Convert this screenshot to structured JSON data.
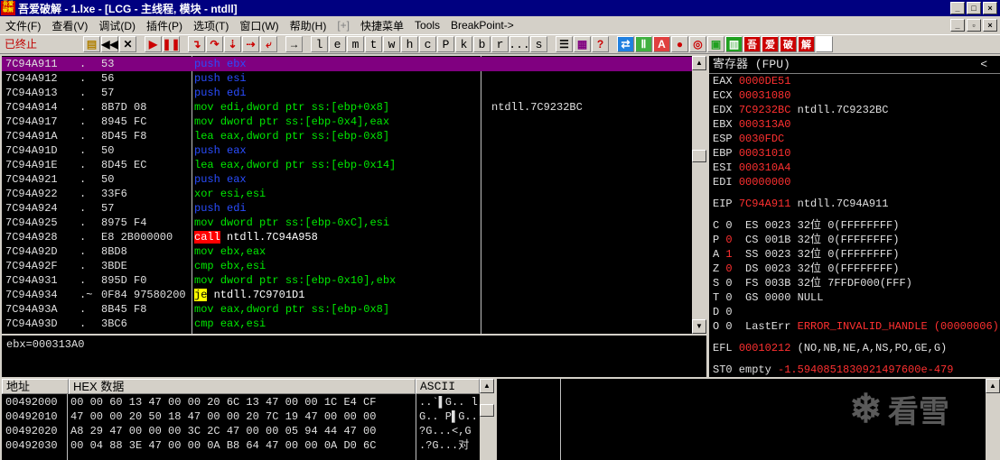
{
  "titlebar": {
    "icon_text": "吾爱破解",
    "title": "吾爱破解 - 1.lxe - [LCG - 主线程, 模块 - ntdll]"
  },
  "menu": [
    "文件(F)",
    "查看(V)",
    "调试(D)",
    "插件(P)",
    "选项(T)",
    "窗口(W)",
    "帮助(H)",
    "[+]",
    "快捷菜单",
    "Tools",
    "BreakPoint->"
  ],
  "toolbar": {
    "status": "已终止",
    "letters": [
      "l",
      "e",
      "m",
      "t",
      "w",
      "h",
      "c",
      "P",
      "k",
      "b",
      "r",
      "...",
      "s"
    ]
  },
  "disasm": {
    "rows": [
      {
        "addr": "7C94A911",
        "mark": ".",
        "hex": "53",
        "op": "push",
        "args": "ebx",
        "opclass": "push",
        "comment": "",
        "sel": true
      },
      {
        "addr": "7C94A912",
        "mark": ".",
        "hex": "56",
        "op": "push",
        "args": "esi",
        "opclass": "push",
        "comment": ""
      },
      {
        "addr": "7C94A913",
        "mark": ".",
        "hex": "57",
        "op": "push",
        "args": "edi",
        "opclass": "push",
        "comment": ""
      },
      {
        "addr": "7C94A914",
        "mark": ".",
        "hex": "8B7D 08",
        "op": "mov",
        "args": "edi,dword ptr ss:[ebp+0x8]",
        "opclass": "mov",
        "comment": "ntdll.7C9232BC"
      },
      {
        "addr": "7C94A917",
        "mark": ".",
        "hex": "8945 FC",
        "op": "mov",
        "args": "dword ptr ss:[ebp-0x4],eax",
        "opclass": "mov",
        "comment": ""
      },
      {
        "addr": "7C94A91A",
        "mark": ".",
        "hex": "8D45 F8",
        "op": "lea",
        "args": "eax,dword ptr ss:[ebp-0x8]",
        "opclass": "mov",
        "comment": ""
      },
      {
        "addr": "7C94A91D",
        "mark": ".",
        "hex": "50",
        "op": "push",
        "args": "eax",
        "opclass": "push",
        "comment": ""
      },
      {
        "addr": "7C94A91E",
        "mark": ".",
        "hex": "8D45 EC",
        "op": "lea",
        "args": "eax,dword ptr ss:[ebp-0x14]",
        "opclass": "mov",
        "comment": ""
      },
      {
        "addr": "7C94A921",
        "mark": ".",
        "hex": "50",
        "op": "push",
        "args": "eax",
        "opclass": "push",
        "comment": ""
      },
      {
        "addr": "7C94A922",
        "mark": ".",
        "hex": "33F6",
        "op": "xor",
        "args": "esi,esi",
        "opclass": "mov",
        "comment": ""
      },
      {
        "addr": "7C94A924",
        "mark": ".",
        "hex": "57",
        "op": "push",
        "args": "edi",
        "opclass": "push",
        "comment": ""
      },
      {
        "addr": "7C94A925",
        "mark": ".",
        "hex": "8975 F4",
        "op": "mov",
        "args": "dword ptr ss:[ebp-0xC],esi",
        "opclass": "mov",
        "comment": ""
      },
      {
        "addr": "7C94A928",
        "mark": ".",
        "hex": "E8 2B000000",
        "op": "call",
        "args": "ntdll.7C94A958",
        "opclass": "call",
        "comment": ""
      },
      {
        "addr": "7C94A92D",
        "mark": ".",
        "hex": "8BD8",
        "op": "mov",
        "args": "ebx,eax",
        "opclass": "mov",
        "comment": ""
      },
      {
        "addr": "7C94A92F",
        "mark": ".",
        "hex": "3BDE",
        "op": "cmp",
        "args": "ebx,esi",
        "opclass": "mov",
        "comment": ""
      },
      {
        "addr": "7C94A931",
        "mark": ".",
        "hex": "895D F0",
        "op": "mov",
        "args": "dword ptr ss:[ebp-0x10],ebx",
        "opclass": "mov",
        "comment": ""
      },
      {
        "addr": "7C94A934",
        "mark": ".~",
        "hex": "0F84 97580200",
        "op": "je",
        "args": "ntdll.7C9701D1",
        "opclass": "je",
        "comment": ""
      },
      {
        "addr": "7C94A93A",
        "mark": ".",
        "hex": "8B45 F8",
        "op": "mov",
        "args": "eax,dword ptr ss:[ebp-0x8]",
        "opclass": "mov",
        "comment": ""
      },
      {
        "addr": "7C94A93D",
        "mark": ".",
        "hex": "3BC6",
        "op": "cmp",
        "args": "eax,esi",
        "opclass": "mov",
        "comment": ""
      }
    ]
  },
  "info": {
    "text": "ebx=000313A0"
  },
  "registers": {
    "title": "寄存器 (FPU)",
    "collapse": "<",
    "gp": [
      {
        "name": "EAX",
        "value": "0000DE51",
        "extra": ""
      },
      {
        "name": "ECX",
        "value": "00031080",
        "extra": ""
      },
      {
        "name": "EDX",
        "value": "7C9232BC",
        "extra": "ntdll.7C9232BC"
      },
      {
        "name": "EBX",
        "value": "000313A0",
        "extra": ""
      },
      {
        "name": "ESP",
        "value": "0030FDC",
        "extra": ""
      },
      {
        "name": "EBP",
        "value": "00031010",
        "extra": ""
      },
      {
        "name": "ESI",
        "value": "000310A4",
        "extra": ""
      },
      {
        "name": "EDI",
        "value": "00000000",
        "extra": ""
      }
    ],
    "eip": {
      "name": "EIP",
      "value": "7C94A911",
      "extra": "ntdll.7C94A911"
    },
    "flags": [
      {
        "f": "C",
        "v": "0",
        "red": false,
        "seg": "ES 0023 32位 0(FFFFFFFF)"
      },
      {
        "f": "P",
        "v": "0",
        "red": true,
        "seg": "CS 001B 32位 0(FFFFFFFF)"
      },
      {
        "f": "A",
        "v": "1",
        "red": true,
        "seg": "SS 0023 32位 0(FFFFFFFF)"
      },
      {
        "f": "Z",
        "v": "0",
        "red": true,
        "seg": "DS 0023 32位 0(FFFFFFFF)"
      },
      {
        "f": "S",
        "v": "0",
        "red": false,
        "seg": "FS 003B 32位 7FFDF000(FFF)"
      },
      {
        "f": "T",
        "v": "0",
        "red": false,
        "seg": "GS 0000 NULL"
      },
      {
        "f": "D",
        "v": "0",
        "red": false,
        "seg": ""
      }
    ],
    "lasterr": {
      "label": "O 0  LastErr",
      "value": "ERROR_INVALID_HANDLE (00000006)"
    },
    "efl": {
      "label": "EFL",
      "value": "00010212",
      "extra": "(NO,NB,NE,A,NS,PO,GE,G)"
    },
    "st0": {
      "label": "ST0 empty",
      "value": "-1.5940851830921497600e-479"
    }
  },
  "dump": {
    "headers": {
      "addr": "地址",
      "hex": "HEX 数据",
      "ascii": "ASCII"
    },
    "rows": [
      {
        "addr": "00492000",
        "hex": "00 00 60 13 47 00 00 20 6C 13 47 00 00 1C E4 CF",
        "ascii": "..`▌G.. l"
      },
      {
        "addr": "00492010",
        "hex": "47 00 00 20 50 18 47 00 00 20 7C 19 47 00 00 00",
        "ascii": "G.. P▌G.."
      },
      {
        "addr": "00492020",
        "hex": "A8 29 47 00 00 00 3C 2C 47 00 00 05 94 44 47 00",
        "ascii": "?G...<,G"
      },
      {
        "addr": "00492030",
        "hex": "00 04 88 3E 47 00 00 0A B8 64 47 00 00 0A D0 6C",
        "ascii": ".?G...对"
      }
    ]
  },
  "watermark": {
    "text": "看雪"
  },
  "colors": {
    "push": "#2a4dff",
    "mov": "#00e800",
    "call_bg": "#ff0000",
    "je_bg": "#ffff00",
    "selected_row": "#800080",
    "reg_value": "#ff3030"
  }
}
